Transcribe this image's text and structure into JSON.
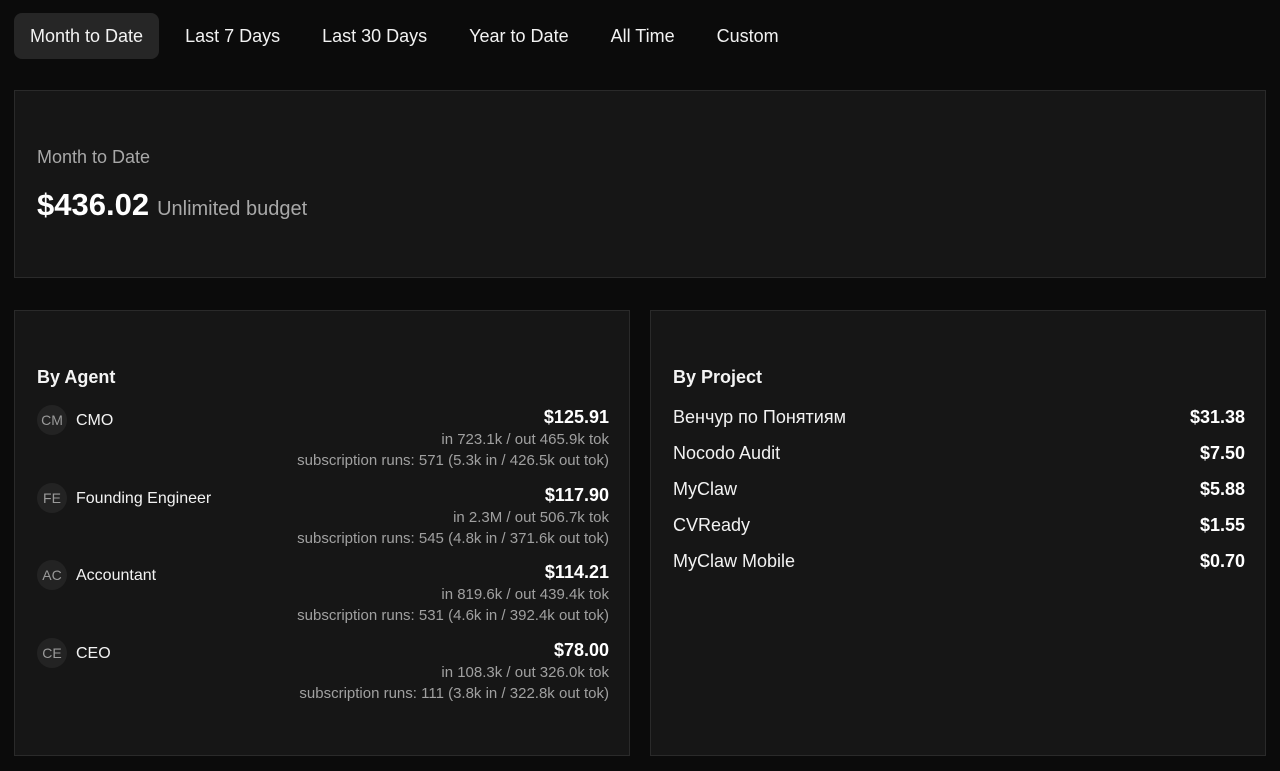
{
  "tabs": [
    {
      "label": "Month to Date",
      "active": true
    },
    {
      "label": "Last 7 Days",
      "active": false
    },
    {
      "label": "Last 30 Days",
      "active": false
    },
    {
      "label": "Year to Date",
      "active": false
    },
    {
      "label": "All Time",
      "active": false
    },
    {
      "label": "Custom",
      "active": false
    }
  ],
  "summary": {
    "label": "Month to Date",
    "amount": "$436.02",
    "budget": "Unlimited budget"
  },
  "by_agent": {
    "title": "By Agent",
    "items": [
      {
        "initials": "CM",
        "name": "CMO",
        "cost": "$125.91",
        "tokens": "in 723.1k / out 465.9k tok",
        "subscription": "subscription runs: 571 (5.3k in / 426.5k out tok)"
      },
      {
        "initials": "FE",
        "name": "Founding Engineer",
        "cost": "$117.90",
        "tokens": "in 2.3M / out 506.7k tok",
        "subscription": "subscription runs: 545 (4.8k in / 371.6k out tok)"
      },
      {
        "initials": "AC",
        "name": "Accountant",
        "cost": "$114.21",
        "tokens": "in 819.6k / out 439.4k tok",
        "subscription": "subscription runs: 531 (4.6k in / 392.4k out tok)"
      },
      {
        "initials": "CE",
        "name": "CEO",
        "cost": "$78.00",
        "tokens": "in 108.3k / out 326.0k tok",
        "subscription": "subscription runs: 111 (3.8k in / 322.8k out tok)"
      }
    ]
  },
  "by_project": {
    "title": "By Project",
    "items": [
      {
        "name": "Венчур по Понятиям",
        "cost": "$31.38"
      },
      {
        "name": "Nocodo Audit",
        "cost": "$7.50"
      },
      {
        "name": "MyClaw",
        "cost": "$5.88"
      },
      {
        "name": "CVReady",
        "cost": "$1.55"
      },
      {
        "name": "MyClaw Mobile",
        "cost": "$0.70"
      }
    ]
  },
  "colors": {
    "background": "#0b0b0b",
    "card": "#161616",
    "active_tab": "#262626",
    "muted_text": "#a0a0a0"
  }
}
